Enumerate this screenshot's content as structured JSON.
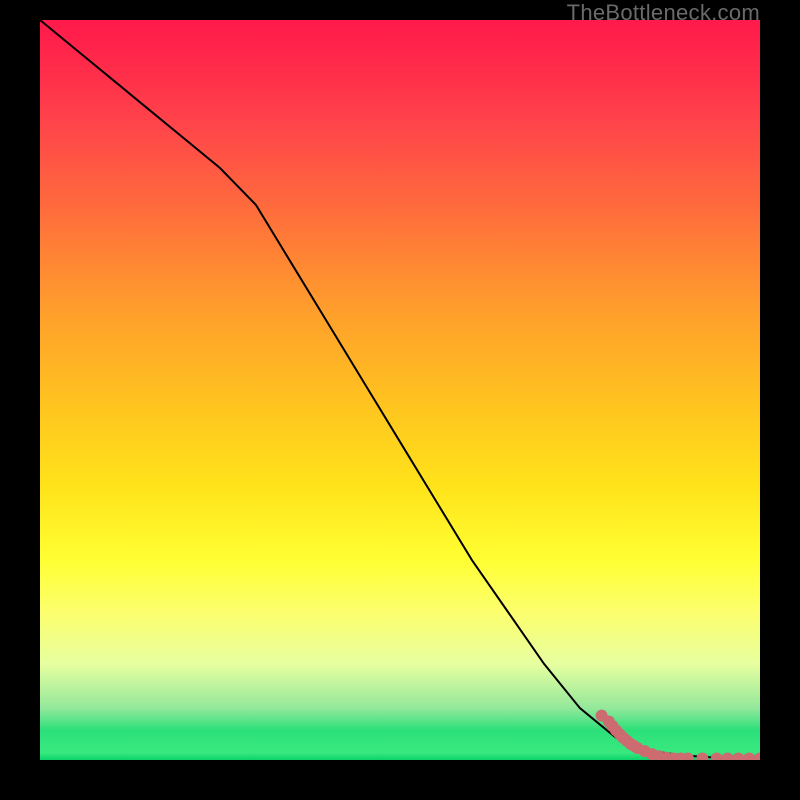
{
  "watermark": "TheBottleneck.com",
  "colors": {
    "page_bg": "#000000",
    "curve": "#000000",
    "dot": "#cc6b70",
    "gradient_top": "#ff1a4b",
    "gradient_mid": "#ffe31a",
    "gradient_bottom": "#0ad36a"
  },
  "chart_data": {
    "type": "line",
    "title": "",
    "xlabel": "",
    "ylabel": "",
    "xlim": [
      0,
      100
    ],
    "ylim": [
      0,
      100
    ],
    "grid": false,
    "legend": false,
    "series": [
      {
        "name": "curve",
        "x": [
          0,
          5,
          10,
          15,
          20,
          25,
          30,
          35,
          40,
          45,
          50,
          55,
          60,
          65,
          70,
          75,
          80,
          82,
          85,
          88,
          91,
          94,
          97,
          100
        ],
        "y": [
          100,
          96,
          92,
          88,
          84,
          80,
          75,
          67,
          59,
          51,
          43,
          35,
          27,
          20,
          13,
          7,
          3,
          2,
          1.2,
          0.8,
          0.5,
          0.3,
          0.2,
          0.2
        ]
      }
    ],
    "scatter": {
      "name": "tail-dots",
      "points": [
        {
          "x": 78,
          "y": 6.0
        },
        {
          "x": 79,
          "y": 5.2
        },
        {
          "x": 79.5,
          "y": 4.6
        },
        {
          "x": 80,
          "y": 4.0
        },
        {
          "x": 80.5,
          "y": 3.5
        },
        {
          "x": 81,
          "y": 3.0
        },
        {
          "x": 81.5,
          "y": 2.6
        },
        {
          "x": 82,
          "y": 2.2
        },
        {
          "x": 82.5,
          "y": 1.9
        },
        {
          "x": 83,
          "y": 1.6
        },
        {
          "x": 84,
          "y": 1.2
        },
        {
          "x": 85,
          "y": 0.8
        },
        {
          "x": 86,
          "y": 0.5
        },
        {
          "x": 87,
          "y": 0.3
        },
        {
          "x": 88,
          "y": 0.2
        },
        {
          "x": 89,
          "y": 0.2
        },
        {
          "x": 90,
          "y": 0.2
        },
        {
          "x": 92,
          "y": 0.2
        },
        {
          "x": 94,
          "y": 0.2
        },
        {
          "x": 95.5,
          "y": 0.2
        },
        {
          "x": 97,
          "y": 0.2
        },
        {
          "x": 98.5,
          "y": 0.2
        },
        {
          "x": 100,
          "y": 0.2
        }
      ]
    }
  }
}
